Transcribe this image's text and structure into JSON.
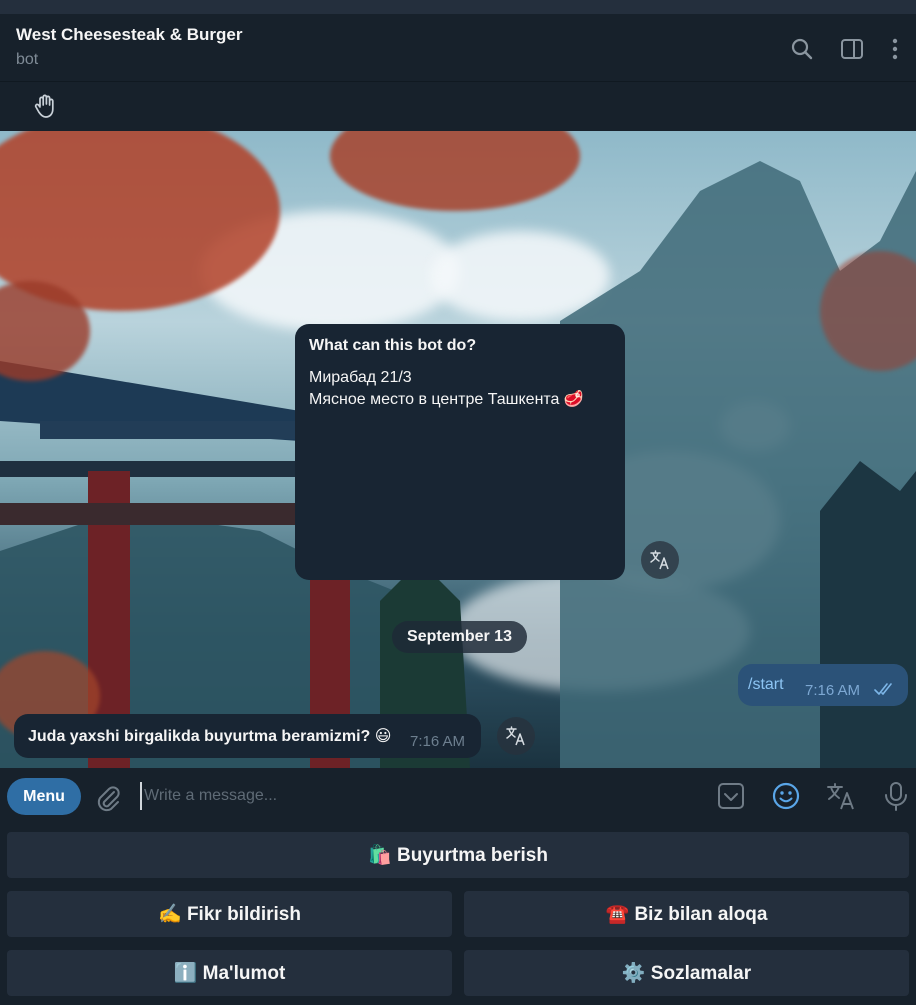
{
  "header": {
    "title": "West Cheesesteak & Burger",
    "subtitle": "bot"
  },
  "bot_info": {
    "title": "What can this bot do?",
    "line1": "Мирабад 21/3",
    "line2": "Мясное место в центре Ташкента 🥩"
  },
  "date_divider": "September 13",
  "messages": [
    {
      "direction": "out",
      "text": "/start",
      "time": "7:16 AM",
      "status": "read"
    },
    {
      "direction": "in",
      "text": "Juda yaxshi birgalikda buyurtma beramizmi? 😃",
      "time": "7:16 AM"
    }
  ],
  "composer": {
    "menu_label": "Menu",
    "placeholder": "Write a message..."
  },
  "keyboard": {
    "order": "🛍️ Buyurtma berish",
    "feedback": "✍️ Fikr bildirish",
    "contact": "☎️ Biz bilan aloqa",
    "info": "ℹ️ Ma'lumot",
    "settings": "⚙️ Sozlamalar"
  },
  "colors": {
    "background": "#17212b",
    "incoming_bubble": "#182533",
    "outgoing_bubble": "#2b5278",
    "accent": "#2f6ea5",
    "keyboard_button": "#242f3d"
  },
  "icons": [
    "search-icon",
    "sidebar-toggle-icon",
    "more-vertical-icon",
    "waving-hand-icon",
    "translate-icon",
    "double-check-icon",
    "paperclip-icon",
    "bot-commands-icon",
    "emoji-icon",
    "translate-icon",
    "microphone-icon"
  ]
}
